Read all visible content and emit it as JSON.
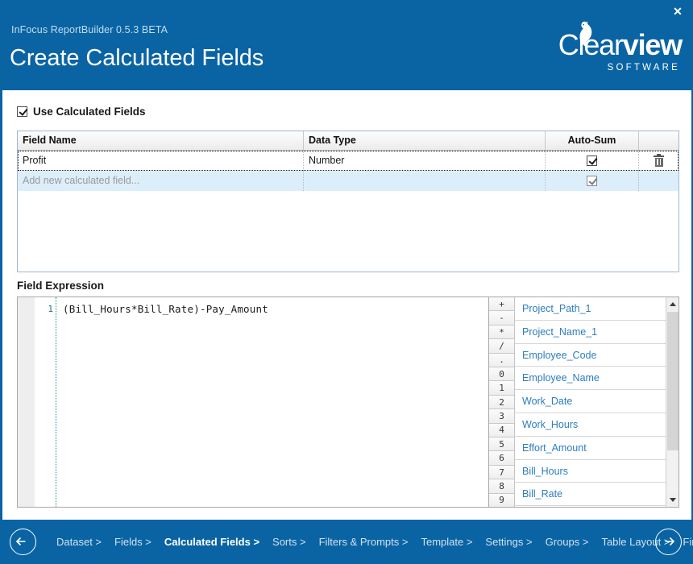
{
  "window": {
    "close_label": "✕",
    "accent_color": "#0a64a4"
  },
  "header": {
    "app_version": "InFocus ReportBuilder 0.5.3 BETA",
    "title": "Create Calculated Fields",
    "logo": {
      "text_light": "Clear",
      "text_bold": "view",
      "subtitle": "SOFTWARE"
    }
  },
  "options": {
    "use_calculated_fields_label": "Use Calculated Fields",
    "use_calculated_fields_checked": true
  },
  "grid": {
    "columns": [
      "Field Name",
      "Data Type",
      "Auto-Sum",
      ""
    ],
    "rows": [
      {
        "field_name": "Profit",
        "data_type": "Number",
        "auto_sum": true,
        "selected": true,
        "delete_icon": "trash-icon"
      }
    ],
    "new_row": {
      "placeholder": "Add new calculated field...",
      "data_type": "",
      "auto_sum": true
    }
  },
  "expression": {
    "section_label": "Field Expression",
    "line_number": "1",
    "code": "(Bill_Hours*Bill_Rate)-Pay_Amount"
  },
  "keypad": {
    "keys": [
      "+",
      "-",
      "*",
      "/",
      ".",
      "0",
      "1",
      "2",
      "3",
      "4",
      "5",
      "6",
      "7",
      "8",
      "9"
    ]
  },
  "field_list": {
    "items": [
      "Project_Path_1",
      "Project_Name_1",
      "Employee_Code",
      "Employee_Name",
      "Work_Date",
      "Work_Hours",
      "Effort_Amount",
      "Bill_Hours",
      "Bill_Rate"
    ]
  },
  "footer": {
    "prev_icon": "arrow-left-icon",
    "next_icon": "arrow-right-icon",
    "breadcrumbs": [
      {
        "label": "Dataset >",
        "active": false
      },
      {
        "label": "Fields >",
        "active": false
      },
      {
        "label": "Calculated Fields >",
        "active": true
      },
      {
        "label": "Sorts >",
        "active": false
      },
      {
        "label": "Filters & Prompts >",
        "active": false
      },
      {
        "label": "Template >",
        "active": false
      },
      {
        "label": "Settings >",
        "active": false
      },
      {
        "label": "Groups >",
        "active": false
      },
      {
        "label": "Table Layout >",
        "active": false
      },
      {
        "label": "Finish",
        "active": false
      }
    ]
  }
}
